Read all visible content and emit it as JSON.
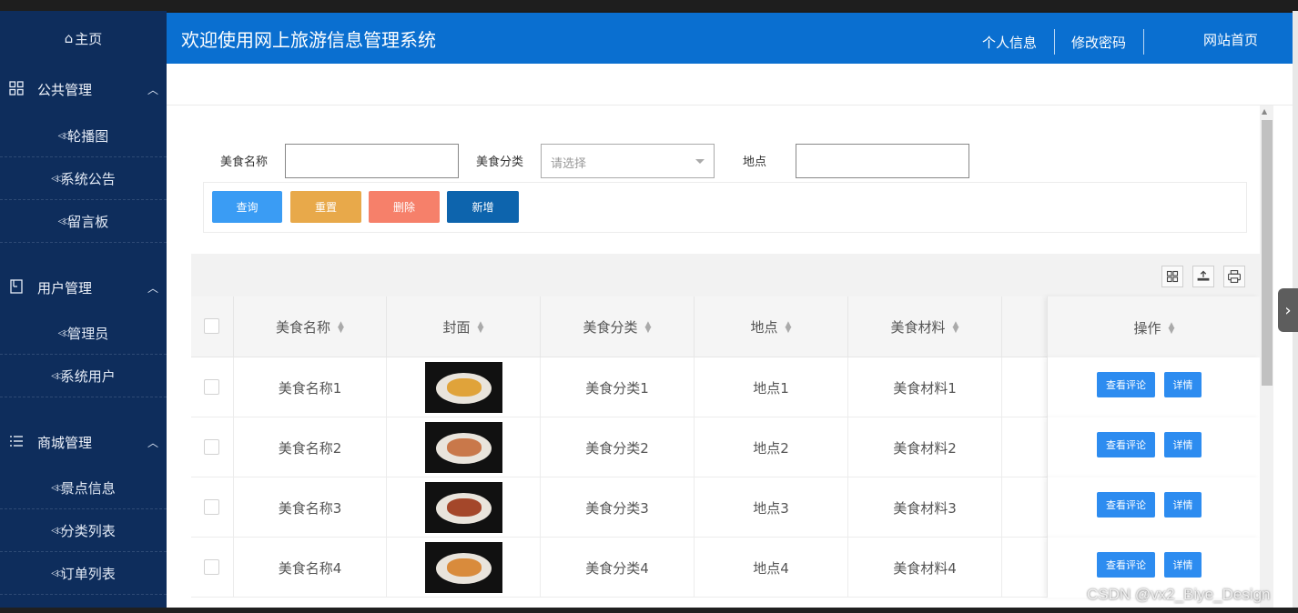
{
  "sidebar": {
    "home_label": "主页",
    "groups": [
      {
        "label": "公共管理",
        "items": [
          "轮播图",
          "系统公告",
          "留言板"
        ]
      },
      {
        "label": "用户管理",
        "items": [
          "管理员",
          "系统用户"
        ]
      },
      {
        "label": "商城管理",
        "items": [
          "景点信息",
          "分类列表",
          "订单列表"
        ]
      }
    ]
  },
  "header": {
    "title": "欢迎使用网上旅游信息管理系统",
    "nav": [
      "个人信息",
      "修改密码",
      "网站首页"
    ]
  },
  "filters": {
    "name_label": "美食名称",
    "category_label": "美食分类",
    "category_placeholder": "请选择",
    "location_label": "地点"
  },
  "actions": {
    "query": "查询",
    "reset": "重置",
    "delete": "删除",
    "add": "新增"
  },
  "table": {
    "columns": [
      "美食名称",
      "封面",
      "美食分类",
      "地点",
      "美食材料",
      "操作"
    ],
    "rows": [
      {
        "name": "美食名称1",
        "category": "美食分类1",
        "location": "地点1",
        "material": "美食材料1"
      },
      {
        "name": "美食名称2",
        "category": "美食分类2",
        "location": "地点2",
        "material": "美食材料2"
      },
      {
        "name": "美食名称3",
        "category": "美食分类3",
        "location": "地点3",
        "material": "美食材料3"
      },
      {
        "name": "美食名称4",
        "category": "美食分类4",
        "location": "地点4",
        "material": "美食材料4"
      }
    ],
    "row_actions": {
      "comments": "查看评论",
      "detail": "详情"
    }
  },
  "watermark": "CSDN @vx2_Biye_Design",
  "colors": {
    "sidebar": "#0e2d5c",
    "header": "#0a6fd0",
    "query_button": "#3a9cf4",
    "reset_button": "#e8a94a",
    "delete_button": "#f6806a",
    "add_button": "#0d64ad"
  }
}
